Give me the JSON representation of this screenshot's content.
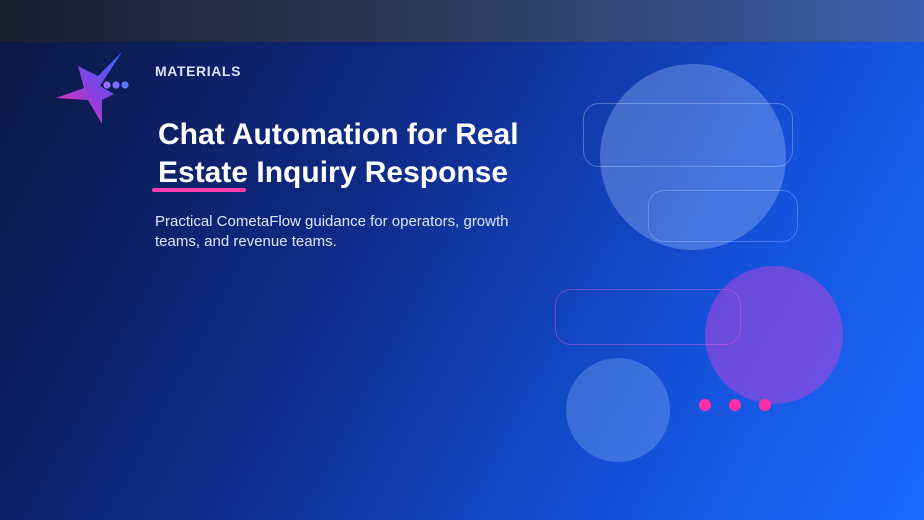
{
  "header": {
    "eyebrow": "MATERIALS",
    "title": "Chat Automation for Real Estate Inquiry Response",
    "subtitle": "Practical CometaFlow guidance for operators, growth teams, and revenue teams."
  },
  "logo": {
    "icon": "star-chat-logo-icon"
  },
  "colors": {
    "accent": "#ff3fae",
    "title_text": "#ffffff",
    "background_start": "#0b1640",
    "background_end": "#1b6cff"
  }
}
